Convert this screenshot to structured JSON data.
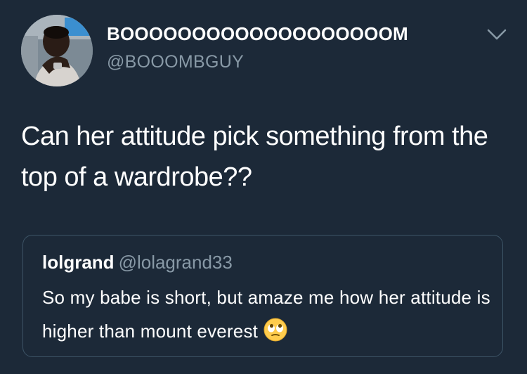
{
  "tweet": {
    "display_name": "BOOOOOOOOOOOOOOOOOOOM",
    "handle": "@BOOOMBGUY",
    "text": "Can her attitude pick something from the top of a wardrobe??"
  },
  "quoted_tweet": {
    "display_name": "lolgrand",
    "handle": "@lolagrand33",
    "text": "So my babe is short, but amaze me how her attitude is  higher than mount everest",
    "emoji": "face-with-rolling-eyes"
  },
  "colors": {
    "background": "#1c2938",
    "secondary_text": "#8899a6",
    "card_border": "#3d5466"
  },
  "icons": {
    "menu": "chevron-down-icon",
    "emoji": "rolling-eyes-emoji-icon"
  }
}
